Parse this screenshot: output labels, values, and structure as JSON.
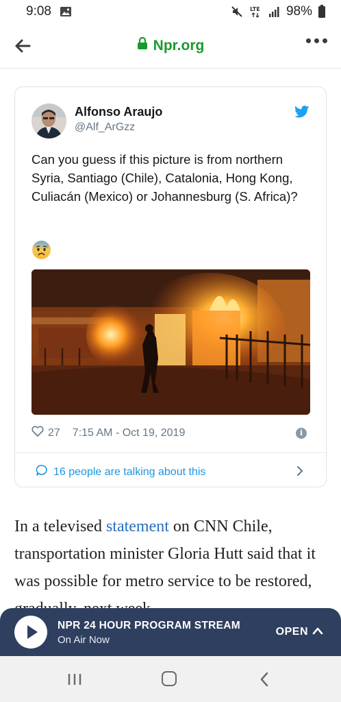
{
  "status": {
    "time": "9:08",
    "battery": "98%",
    "network": "LTE"
  },
  "browser": {
    "url": "Npr.org"
  },
  "tweet": {
    "author_name": "Alfonso Araujo",
    "handle": "@Alf_ArGzz",
    "text": "Can you guess if this picture is from northern Syria, Santiago (Chile), Catalonia, Hong Kong, Culiacán (Mexico) or Johannesburg (S. Africa)?",
    "emoji": "anxious-face-with-sweat",
    "likes": "27",
    "timestamp": "7:15 AM - Oct 19, 2019",
    "talking": "16 people are talking about this"
  },
  "article": {
    "pre_link": "In a televised ",
    "link_text": "statement",
    "post_link": " on CNN Chile, transportation minister Gloria Hutt said that it was possible for metro service to be restored, gradually, next week."
  },
  "stream": {
    "title": "NPR 24 HOUR PROGRAM STREAM",
    "subtitle": "On Air Now",
    "open_label": "OPEN"
  },
  "colors": {
    "url_green": "#1a9a2e",
    "twitter_blue": "#1da1f2",
    "stream_bg": "#2f3f5f",
    "link_blue": "#2a6ebb"
  }
}
